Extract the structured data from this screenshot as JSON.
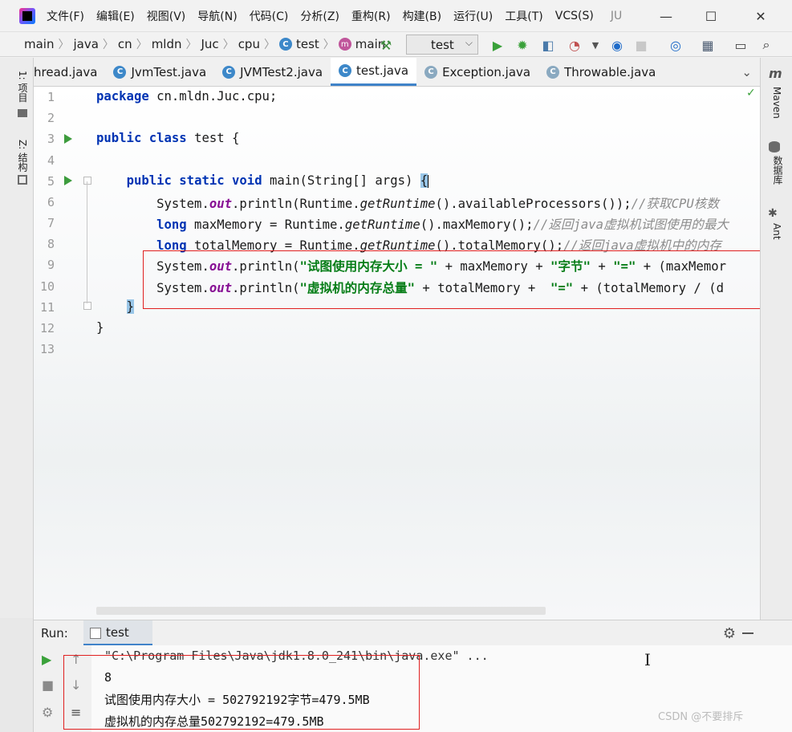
{
  "menu": {
    "items": [
      "文件(F)",
      "编辑(E)",
      "视图(V)",
      "导航(N)",
      "代码(C)",
      "分析(Z)",
      "重构(R)",
      "构建(B)",
      "运行(U)",
      "工具(T)",
      "VCS(S)"
    ],
    "extra": "JU"
  },
  "window": {
    "minimize": "—",
    "maximize": "☐",
    "close": "✕"
  },
  "breadcrumb": [
    "main",
    "java",
    "cn",
    "mldn",
    "Juc",
    "cpu",
    "test",
    "main"
  ],
  "icons": {
    "class_letter": "C",
    "method_letter": "m",
    "maven": "m",
    "check": "✓"
  },
  "run_config": {
    "label": "test"
  },
  "tabs": [
    {
      "label": "hread.java",
      "active": false
    },
    {
      "label": "JvmTest.java",
      "active": false
    },
    {
      "label": "JVMTest2.java",
      "active": false
    },
    {
      "label": "test.java",
      "active": true
    },
    {
      "label": "Exception.java",
      "active": false
    },
    {
      "label": "Throwable.java",
      "active": false
    }
  ],
  "left_tools": [
    "1: 项目",
    "Z: 结构"
  ],
  "right_tools": [
    "Maven",
    "数据库",
    "Ant"
  ],
  "line_numbers": [
    "1",
    "2",
    "3",
    "4",
    "5",
    "6",
    "7",
    "8",
    "9",
    "10",
    "11",
    "12",
    "13"
  ],
  "code": {
    "l1_kw": "package",
    "l1_rest": " cn.mldn.Juc.cpu;",
    "l3_kw1": "public",
    "l3_kw2": "class",
    "l3_rest": " test {",
    "l5_kw1": "public",
    "l5_kw2": "static",
    "l5_kw3": "void",
    "l5_rest": " main(String[] args) ",
    "l5_brace": "{",
    "l6_a": "System.",
    "l6_out": "out",
    "l6_b": ".println(Runtime.",
    "l6_rt": "getRuntime",
    "l6_c": "().availableProcessors());",
    "l6_cm": "//获取CPU核数",
    "l7_kw": "long",
    "l7_a": " maxMemory = Runtime.",
    "l7_rt": "getRuntime",
    "l7_b": "().maxMemory();",
    "l7_cm": "//返回java虚拟机试图使用的最大",
    "l8_kw": "long",
    "l8_a": " totalMemory = Runtime.",
    "l8_rt": "getRuntime",
    "l8_b": "().totalMemory();",
    "l8_cm": "//返回java虚拟机中的内存",
    "l9_a": "System.",
    "l9_out": "out",
    "l9_b": ".println(",
    "l9_s1": "\"试图使用内存大小 = \"",
    "l9_c": " + maxMemory + ",
    "l9_s2": "\"字节\"",
    "l9_d": " + ",
    "l9_s3": "\"=\"",
    "l9_e": " + (maxMemor",
    "l10_a": "System.",
    "l10_out": "out",
    "l10_b": ".println(",
    "l10_s1": "\"虚拟机的内存总量\"",
    "l10_c": " + totalMemory +  ",
    "l10_s2": "\"=\"",
    "l10_d": " + (totalMemory / (d",
    "l11": "}",
    "l12": "}"
  },
  "run_panel": {
    "title": "Run:",
    "tab": "test",
    "output": [
      "\"C:\\Program Files\\Java\\jdk1.8.0_241\\bin\\java.exe\" ...",
      "8",
      "试图使用内存大小 = 502792192字节=479.5MB",
      "虚拟机的内存总量502792192=479.5MB"
    ]
  },
  "watermark": "CSDN @不要排斥"
}
